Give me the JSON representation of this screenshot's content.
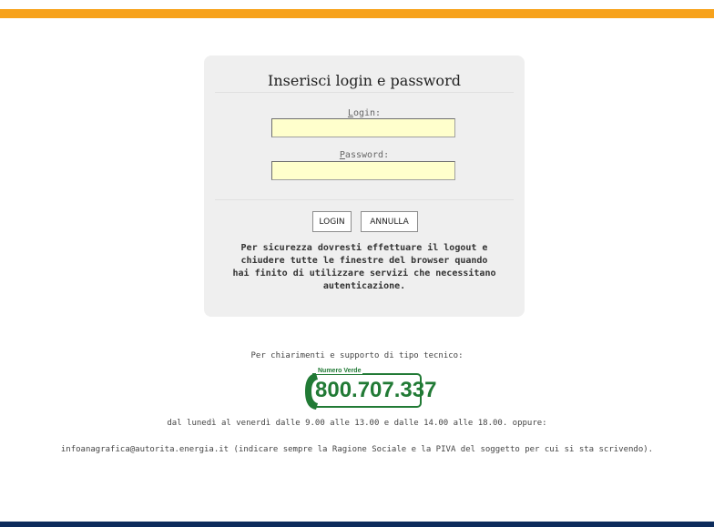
{
  "login_panel": {
    "title": "Inserisci login e password",
    "login_label": {
      "accesskey": "L",
      "rest": "ogin:"
    },
    "login_value": "",
    "password_label": {
      "accesskey": "P",
      "rest": "assword:"
    },
    "password_value": "",
    "login_button": "LOGIN",
    "cancel_button": "ANNULLA",
    "warning_lines": [
      "Per sicurezza dovresti effettuare il logout e",
      "chiudere tutte le finestre del browser quando",
      "hai finito di utilizzare servizi che necessitano",
      "autenticazione."
    ]
  },
  "support": {
    "title": "Per chiarimenti e supporto di tipo tecnico:",
    "numero_verde_label": "Numero Verde",
    "phone_number": "800.707.337",
    "hours": "dal lunedì al venerdì dalle 9.00 alle 13.00 e dalle 14.00 alle 18.00. oppure:",
    "email": "infoanagrafica@autorita.energia.it",
    "email_note": " (indicare sempre la Ragione Sociale e la PIVA del soggetto per cui si sta scrivendo)."
  },
  "colors": {
    "top_bar": "#f7a21b",
    "bottom_bar": "#0d2c5c",
    "numero_verde": "#217a35",
    "input_background": "#ffffcc"
  },
  "icons": {
    "phone": "phone-handset-icon"
  }
}
